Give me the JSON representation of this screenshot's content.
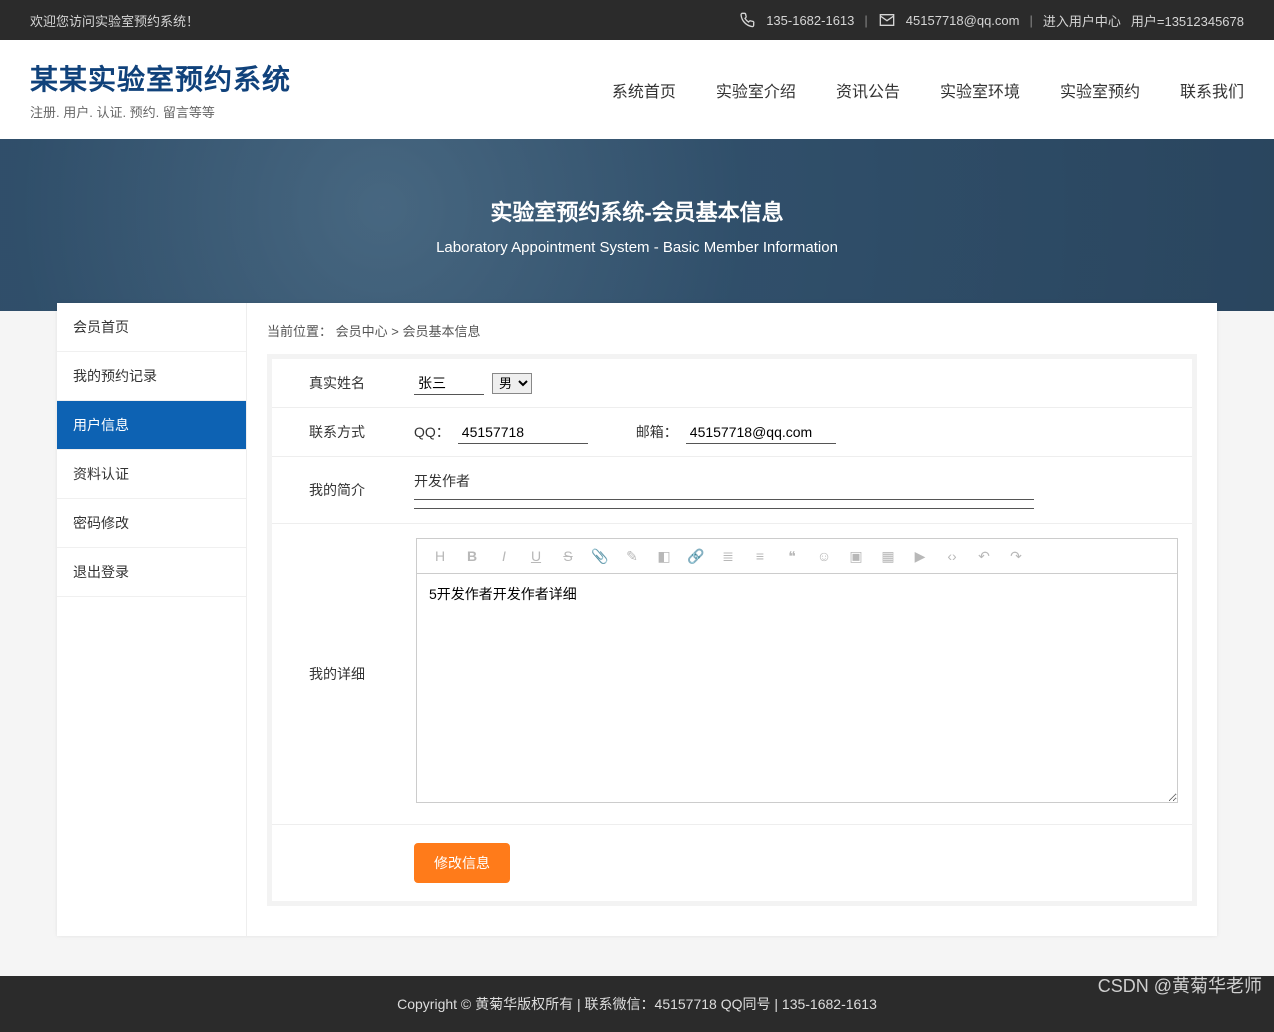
{
  "topbar": {
    "welcome": "欢迎您访问实验室预约系统！",
    "phone": "135-1682-1613",
    "email": "45157718@qq.com",
    "enter_center": "进入用户中心",
    "user_label": "用户=13512345678"
  },
  "header": {
    "title": "某某实验室预约系统",
    "subtitle": "注册. 用户. 认证. 预约. 留言等等",
    "nav": [
      "系统首页",
      "实验室介绍",
      "资讯公告",
      "实验室环境",
      "实验室预约",
      "联系我们"
    ]
  },
  "banner": {
    "title": "实验室预约系统-会员基本信息",
    "subtitle": "Laboratory Appointment System - Basic Member Information"
  },
  "breadcrumb": {
    "label": "当前位置：",
    "center": "会员中心",
    "sep": " > ",
    "current": "会员基本信息"
  },
  "sidebar": {
    "items": [
      {
        "label": "会员首页",
        "active": false
      },
      {
        "label": "我的预约记录",
        "active": false
      },
      {
        "label": "用户信息",
        "active": true
      },
      {
        "label": "资料认证",
        "active": false
      },
      {
        "label": "密码修改",
        "active": false
      },
      {
        "label": "退出登录",
        "active": false
      }
    ]
  },
  "form": {
    "real_name_label": "真实姓名",
    "real_name_value": "张三",
    "gender_selected": "男",
    "contact_label": "联系方式",
    "qq_label": "QQ：",
    "qq_value": "45157718",
    "email_label": "邮箱：",
    "email_value": "45157718@qq.com",
    "intro_label": "我的简介",
    "intro_text": "开发作者",
    "detail_label": "我的详细",
    "detail_value": "5开发作者开发作者详细\n",
    "submit_label": "修改信息"
  },
  "toolbar_icons": [
    "H",
    "B",
    "I",
    "U",
    "S",
    "clip",
    "brush",
    "erase",
    "link",
    "list",
    "align",
    "quote",
    "emoji",
    "image",
    "table",
    "video",
    "code",
    "undo",
    "redo"
  ],
  "footer": {
    "text": "Copyright © 黄菊华版权所有 | 联系微信：45157718 QQ同号 | 135-1682-1613"
  },
  "watermark": "CSDN @黄菊华老师"
}
